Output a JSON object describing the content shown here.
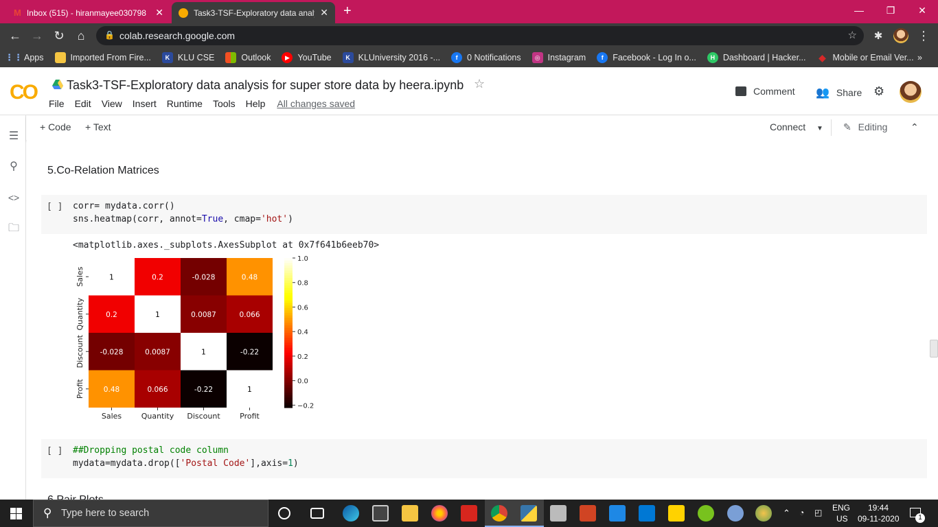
{
  "browser": {
    "tabs": [
      {
        "title": "Inbox (515) - hiranmayee030798",
        "active": false
      },
      {
        "title": "Task3-TSF-Exploratory data analy",
        "active": true
      }
    ],
    "url": "colab.research.google.com",
    "bookmarks": [
      {
        "label": "Apps",
        "icon": "apps-grid-icon",
        "color": "#4285f4"
      },
      {
        "label": "Imported From Fire...",
        "icon": "folder-icon",
        "color": "#f5c542"
      },
      {
        "label": "KLU CSE",
        "icon": "klu-icon",
        "color": "#2b4a9c"
      },
      {
        "label": "Outlook",
        "icon": "windows-icon",
        "color": "#0078d4"
      },
      {
        "label": "YouTube",
        "icon": "youtube-icon",
        "color": "#ff0000"
      },
      {
        "label": "KLUniversity 2016 -...",
        "icon": "klu-icon",
        "color": "#2b4a9c"
      },
      {
        "label": "0 Notifications",
        "icon": "facebook-icon",
        "color": "#1877f2"
      },
      {
        "label": "Instagram",
        "icon": "instagram-icon",
        "color": "#c13584"
      },
      {
        "label": "Facebook - Log In o...",
        "icon": "facebook-icon",
        "color": "#1877f2"
      },
      {
        "label": "Dashboard | Hacker...",
        "icon": "hackerrank-icon",
        "color": "#2ec866"
      },
      {
        "label": "Mobile or Email Ver...",
        "icon": "diamond-icon",
        "color": "#d62828"
      }
    ],
    "more_bookmarks": "»"
  },
  "colab": {
    "logo": "CO",
    "title": "Task3-TSF-Exploratory data analysis for super store data by heera.ipynb",
    "menu": [
      "File",
      "Edit",
      "View",
      "Insert",
      "Runtime",
      "Tools",
      "Help"
    ],
    "save_status": "All changes saved",
    "comment_label": "Comment",
    "share_label": "Share",
    "add_code": "+ Code",
    "add_text": "+ Text",
    "connect": "Connect",
    "editing": "Editing"
  },
  "notebook": {
    "heading": "5.Co-Relation Matrices",
    "cell1": {
      "bracket": "[ ]",
      "line1": "corr= mydata.corr()",
      "line2_pre": "sns.heatmap(corr, annot=",
      "line2_true": "True",
      "line2_mid": ", cmap=",
      "line2_str": "'hot'",
      "line2_end": ")"
    },
    "output": "<matplotlib.axes._subplots.AxesSubplot at 0x7f641b6eeb70>",
    "cell2": {
      "bracket": "[ ]",
      "comment": "##Dropping postal code column",
      "line2_pre": "mydata=mydata.drop([",
      "line2_str": "'Postal Code'",
      "line2_mid": "],axis=",
      "line2_num": "1",
      "line2_end": ")"
    },
    "next_heading_partial": "6.Pair Plots"
  },
  "chart_data": {
    "type": "heatmap",
    "categories": [
      "Sales",
      "Quantity",
      "Discount",
      "Profit"
    ],
    "values": [
      [
        1,
        0.2,
        -0.028,
        0.48
      ],
      [
        0.2,
        1,
        0.0087,
        0.066
      ],
      [
        -0.028,
        0.0087,
        1,
        -0.22
      ],
      [
        0.48,
        0.066,
        -0.22,
        1
      ]
    ],
    "annotations": [
      [
        "1",
        "0.2",
        "-0.028",
        "0.48"
      ],
      [
        "0.2",
        "1",
        "0.0087",
        "0.066"
      ],
      [
        "-0.028",
        "0.0087",
        "1",
        "-0.22"
      ],
      [
        "0.48",
        "0.066",
        "-0.22",
        "1"
      ]
    ],
    "colormap": "hot",
    "colorbar_range": [
      -0.22,
      1.0
    ],
    "colorbar_ticks": [
      "1.0",
      "0.8",
      "0.6",
      "0.4",
      "0.2",
      "0.0",
      "−0.2"
    ],
    "colorbar_tick_values": [
      1.0,
      0.8,
      0.6,
      0.4,
      0.2,
      0.0,
      -0.2
    ]
  },
  "taskbar": {
    "search_placeholder": "Type here to search",
    "language": "ENG",
    "region": "US",
    "time": "19:44",
    "date": "09-11-2020",
    "notification_count": "1"
  }
}
